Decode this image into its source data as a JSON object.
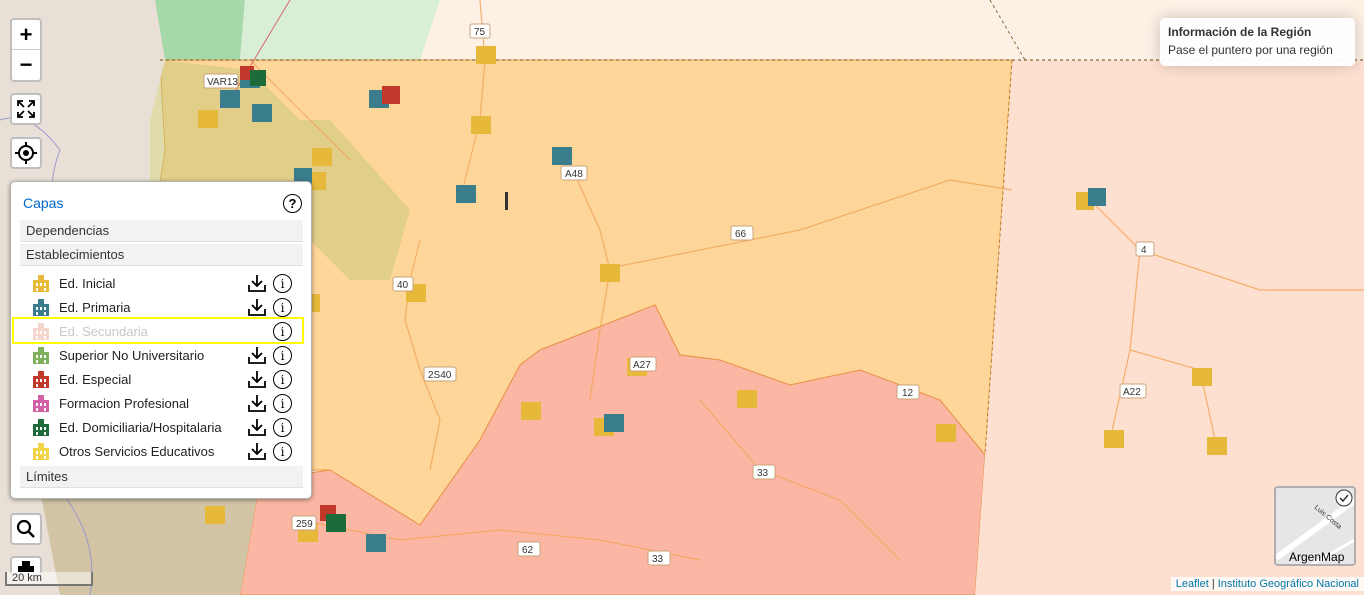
{
  "map": {
    "road_labels": [
      "75",
      "A48",
      "66",
      "40",
      "2S40",
      "A27",
      "12",
      "4",
      "A22",
      "33",
      "33",
      "62",
      "259",
      "VAR13"
    ],
    "colors": {
      "region_yellow": "#ffd699",
      "region_red": "#fcb6a4",
      "region_peach": "#fde0d0",
      "region_green": "#a6d9a9"
    }
  },
  "controls": {
    "zoom_in": "+",
    "zoom_out": "−"
  },
  "info": {
    "title": "Información de la Región",
    "subtitle": "Pase el puntero por una región"
  },
  "layers": {
    "header": "Capas",
    "help": "?",
    "sections": [
      "Dependencias",
      "Establecimientos",
      "Límites"
    ],
    "items": [
      {
        "label": "Ed. Inicial",
        "color": "#e7b93a",
        "enabled": true
      },
      {
        "label": "Ed. Primaria",
        "color": "#3a7d8d",
        "enabled": true
      },
      {
        "label": "Ed. Secundaria",
        "color": "#f4c4b4",
        "enabled": false
      },
      {
        "label": "Superior No Universitario",
        "color": "#7fb05b",
        "enabled": true
      },
      {
        "label": "Ed. Especial",
        "color": "#c0392b",
        "enabled": true
      },
      {
        "label": "Formacion Profesional",
        "color": "#d35fa6",
        "enabled": true
      },
      {
        "label": "Ed. Domiciliaria/Hospitalaria",
        "color": "#1e6b3a",
        "enabled": true
      },
      {
        "label": "Otros Servicios Educativos",
        "color": "#f2d44a",
        "enabled": true
      }
    ]
  },
  "minimap": {
    "label": "ArgenMap",
    "street": "Luis Costa"
  },
  "scale": "20 km",
  "attribution": {
    "leaflet": "Leaflet",
    "sep": " | ",
    "ign": "Instituto Geográfico Nacional"
  }
}
